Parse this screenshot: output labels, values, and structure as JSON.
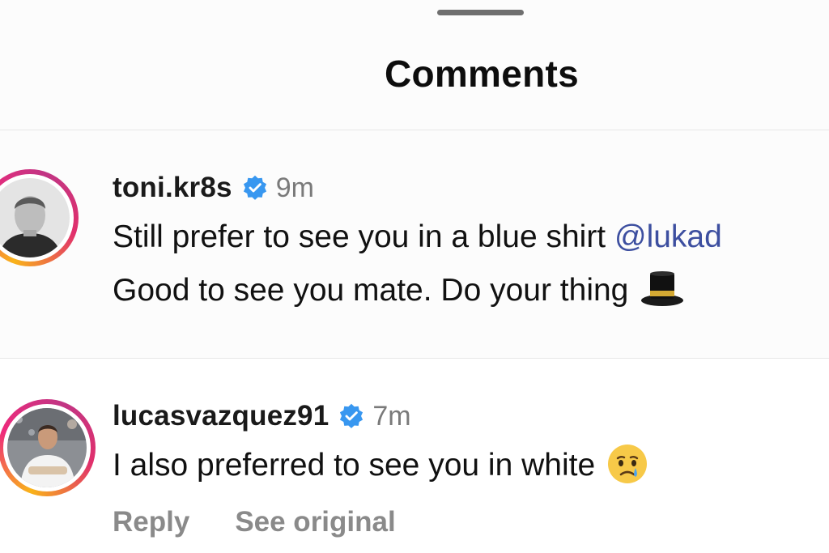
{
  "sheet": {
    "title": "Comments"
  },
  "comments": [
    {
      "username": "toni.kr8s",
      "verified": true,
      "time": "9m",
      "text_line_1": "Still prefer to see you in a blue shirt ",
      "mention": "@lukad",
      "text_line_2": "Good to see you mate. Do your thing",
      "emoji": "top-hat-emoji"
    },
    {
      "username": "lucasvazquez91",
      "verified": true,
      "time": "7m",
      "text_line_1": "I also preferred to see you in white",
      "emoji": "crying-face-emoji",
      "actions": {
        "reply": "Reply",
        "see_original": "See original"
      }
    }
  ],
  "colors": {
    "verified_badge": "#3897f0",
    "mention": "#3d4fa0",
    "muted_text": "#8a8a8a"
  }
}
